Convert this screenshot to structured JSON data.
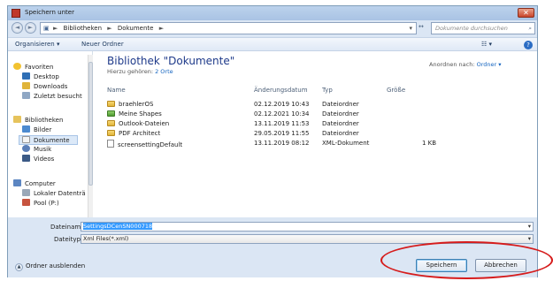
{
  "window": {
    "title": "Speichern unter",
    "close_glyph": "✕"
  },
  "address": {
    "back_glyph": "◄",
    "forward_glyph": "►",
    "segments": [
      "Bibliotheken",
      "Dokumente"
    ],
    "separator": "►",
    "dropdown_glyph": "▾",
    "refresh_glyph": "↔"
  },
  "search": {
    "placeholder": "Dokumente durchsuchen",
    "icon_glyph": "⌕"
  },
  "toolbar": {
    "organize": "Organisieren ▾",
    "new_folder": "Neuer Ordner",
    "view_glyph": "☷ ▾",
    "help_glyph": "?"
  },
  "sidebar": {
    "favorites": {
      "label": "Favoriten",
      "items": [
        "Desktop",
        "Downloads",
        "Zuletzt besucht"
      ]
    },
    "libraries": {
      "label": "Bibliotheken",
      "items": [
        "Bilder",
        "Dokumente",
        "Musik",
        "Videos"
      ]
    },
    "computer": {
      "label": "Computer",
      "items": [
        "Lokaler Datenträ",
        "Pool (P:)"
      ]
    }
  },
  "main": {
    "title": "Bibliothek \"Dokumente\"",
    "subtitle_prefix": "Hierzu gehören:",
    "subtitle_link": "2 Orte",
    "arrange_label": "Anordnen nach:",
    "arrange_value": "Ordner ▾",
    "columns": {
      "name": "Name",
      "date": "Änderungsdatum",
      "type": "Typ",
      "size": "Größe"
    },
    "rows": [
      {
        "name": "braehlerOS",
        "date": "02.12.2019 10:43",
        "type": "Dateiordner",
        "size": ""
      },
      {
        "name": "Meine Shapes",
        "date": "02.12.2021 10:34",
        "type": "Dateiordner",
        "size": ""
      },
      {
        "name": "Outlook-Dateien",
        "date": "13.11.2019 11:53",
        "type": "Dateiordner",
        "size": ""
      },
      {
        "name": "PDF Architect",
        "date": "29.05.2019 11:55",
        "type": "Dateiordner",
        "size": ""
      },
      {
        "name": "screensettingDefault",
        "date": "13.11.2019 08:12",
        "type": "XML-Dokument",
        "size": "1 KB"
      }
    ]
  },
  "form": {
    "filename_label": "Dateiname:",
    "filename_value": "SettingsDCenSN000718",
    "filetype_label": "Dateityp:",
    "filetype_value": "Xml Files(*.xml)",
    "dropdown_glyph": "▾"
  },
  "footer": {
    "hide_folders": "Ordner ausblenden",
    "hide_glyph": "▲",
    "save": "Speichern",
    "cancel": "Abbrechen"
  },
  "colors": {
    "accent": "#1e3a8a",
    "highlight": "#d61c1c",
    "selection": "#3399ff"
  }
}
